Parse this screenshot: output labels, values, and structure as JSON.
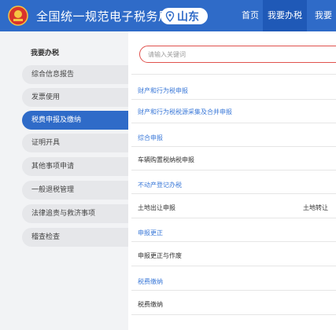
{
  "header": {
    "site_title": "全国统一规范电子税务局",
    "region": "山东",
    "nav": {
      "home": "首页",
      "my_tax": "我要办税",
      "more": "我要"
    },
    "brand_color": "#2f6bc8"
  },
  "sidebar": {
    "title": "我要办税",
    "items": [
      {
        "label": "综合信息报告",
        "active": false
      },
      {
        "label": "发票使用",
        "active": false
      },
      {
        "label": "税费申报及缴纳",
        "active": true
      },
      {
        "label": "证明开具",
        "active": false
      },
      {
        "label": "其他事项申请",
        "active": false
      },
      {
        "label": "一般退税管理",
        "active": false
      },
      {
        "label": "法律追责与救济事项",
        "active": false
      },
      {
        "label": "稽查检查",
        "active": false
      }
    ]
  },
  "main": {
    "search": {
      "placeholder": "请输入关键词"
    },
    "sections": [
      {
        "title": "财产和行为税申报",
        "items": [
          "财产和行为税税源采集及合并申报"
        ]
      },
      {
        "title": "综合申报",
        "items": [
          "车辆购置税纳税申报"
        ]
      },
      {
        "title": "不动产登记办税",
        "items": [
          "土地出让申报",
          "土地转让"
        ]
      },
      {
        "title": "申报更正",
        "items": [
          "申报更正与作废"
        ]
      },
      {
        "title": "税费缴纳",
        "items": [
          "税费缴纳"
        ]
      }
    ],
    "link_color": "#3a78d8",
    "search_border_color": "#e0514d"
  }
}
